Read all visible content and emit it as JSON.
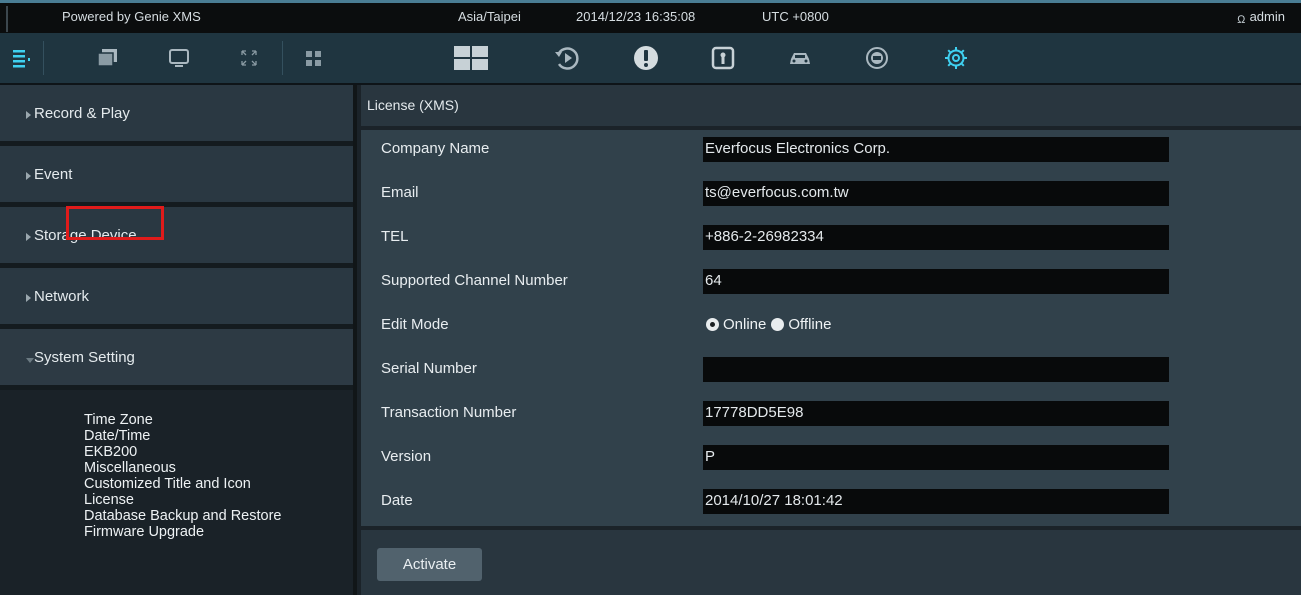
{
  "topbar": {
    "powered_by": "Powered by Genie XMS",
    "timezone": "Asia/Taipei",
    "datetime": "2014/12/23 16:35:08",
    "utc": "UTC +0800",
    "user": "admin"
  },
  "toolbar": {
    "left_icons": [
      "list-menu-icon",
      "layers-icon",
      "monitor-icon",
      "fullscreen-icon",
      "grid-layout-icon"
    ],
    "center_icons": [
      "live-view-icon",
      "playback-icon",
      "alert-icon",
      "info-icon",
      "car-icon",
      "dvr-icon",
      "settings-icon"
    ],
    "active_accent": "#3fd0f0",
    "icon_color": "#aab8c0"
  },
  "sidebar": {
    "sections": [
      {
        "label": "Record & Play"
      },
      {
        "label": "Event"
      },
      {
        "label": "Storage Device"
      },
      {
        "label": "Network"
      },
      {
        "label": "System Setting"
      }
    ],
    "submenu": [
      "Time Zone",
      "Date/Time",
      "EKB200",
      "Miscellaneous",
      "Customized Title and Icon",
      "License",
      "Database Backup and Restore",
      "Firmware Upgrade"
    ],
    "selected_item": "License",
    "highlight_color": "#e01b1b"
  },
  "main": {
    "title": "License (XMS)",
    "fields": [
      {
        "label": "Company Name",
        "value": "Everfocus Electronics Corp."
      },
      {
        "label": "Email",
        "value": "ts@everfocus.com.tw"
      },
      {
        "label": "TEL",
        "value": "+886-2-26982334"
      },
      {
        "label": "Supported Channel Number",
        "value": "64"
      },
      {
        "label": "Edit Mode",
        "options": [
          "Online",
          "Offline"
        ],
        "selected": "Online"
      },
      {
        "label": "Serial Number",
        "value": ""
      },
      {
        "label": "Transaction Number",
        "value": "17778DD5E98"
      },
      {
        "label": "Version",
        "value": "P"
      },
      {
        "label": "Date",
        "value": "2014/10/27 18:01:42"
      }
    ],
    "activate_label": "Activate"
  }
}
